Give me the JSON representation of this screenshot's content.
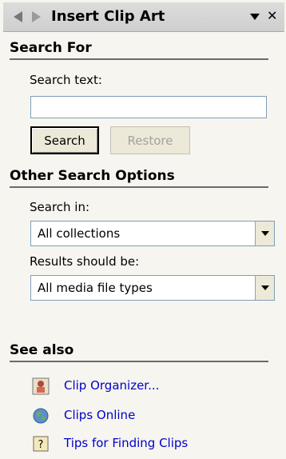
{
  "pane": {
    "title": "Insert Clip Art",
    "back_icon": "arrow-left-icon",
    "forward_icon": "arrow-right-icon",
    "menu_icon": "dropdown-triangle-icon",
    "close_icon": "close-icon",
    "close_glyph": "✕"
  },
  "search": {
    "heading": "Search For",
    "text_label": "Search text:",
    "text_value": "",
    "search_button": "Search",
    "restore_button": "Restore"
  },
  "options": {
    "heading": "Other Search Options",
    "search_in_label": "Search in:",
    "search_in_value": "All collections",
    "results_label": "Results should be:",
    "results_value": "All media file types"
  },
  "see_also": {
    "heading": "See also",
    "links": [
      {
        "label": "Clip Organizer...",
        "icon": "clip-organizer-icon"
      },
      {
        "label": "Clips Online",
        "icon": "globe-icon"
      },
      {
        "label": "Tips for Finding Clips",
        "icon": "help-icon"
      }
    ]
  },
  "colors": {
    "background": "#f6f5ef",
    "link": "#0000cc",
    "disabled_text": "#a3a2a0"
  }
}
